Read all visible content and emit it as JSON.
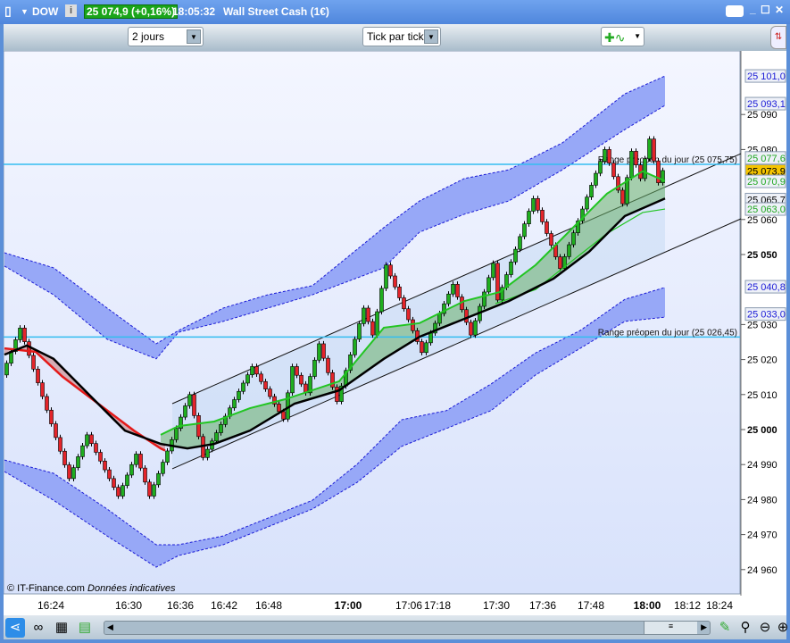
{
  "title_bar": {
    "instrument": "DOW",
    "price": "25 074,9 (+0,16%)",
    "time": "18:05:32",
    "name": "Wall Street Cash (1€)"
  },
  "toolbar": {
    "period": "2 jours",
    "granularity": "Tick par tick"
  },
  "watermark": {
    "copyright": "© IT-Finance.com",
    "note": "Données indicatives"
  },
  "colors": {
    "up": "#1fae1f",
    "down": "#e4242a",
    "band": "#97a8f7",
    "band_edge": "#1b1bd6",
    "cyan": "#33bdf0",
    "ma_red": "#e41a1a",
    "ma_black": "#000000",
    "ma_green": "#22c522"
  },
  "chart_data": {
    "type": "candlestick",
    "title": "Wall Street Cash (1€) - Tick par tick - 2 jours",
    "ylim": [
      24955,
      25110
    ],
    "x_unit": "bar index",
    "xlim": [
      0,
      166
    ],
    "y_ticks": [
      25090,
      25080,
      25060,
      25050,
      25030,
      25020,
      25010,
      25000,
      24990,
      24980,
      24970,
      24960
    ],
    "y_ticks_labels": [
      "25 090",
      "25 080",
      "25 060",
      "25 050",
      "25 030",
      "25 020",
      "25 010",
      "25 000",
      "24 990",
      "24 980",
      "24 970",
      "24 960"
    ],
    "bold_ticks": [
      25050,
      25000
    ],
    "price_labels": [
      {
        "v": 25101.0,
        "text": "25 101,0",
        "color": "#1b1bd6"
      },
      {
        "v": 25093.1,
        "text": "25 093,1",
        "color": "#1b1bd6"
      },
      {
        "v": 25077.6,
        "text": "25 077,6",
        "color": "#22a822"
      },
      {
        "v": 25073.9,
        "text": "25 073,9",
        "color": "#000000",
        "bg": "#f5c400"
      },
      {
        "v": 25070.9,
        "text": "25 070,9",
        "color": "#22a822"
      },
      {
        "v": 25065.7,
        "text": "25 065,7",
        "color": "#000000"
      },
      {
        "v": 25063.0,
        "text": "25 063,0",
        "color": "#22a822"
      },
      {
        "v": 25040.8,
        "text": "25 040,8",
        "color": "#1b1bd6"
      },
      {
        "v": 25033.0,
        "text": "25 033,0",
        "color": "#1b1bd6"
      }
    ],
    "x_ticks": [
      {
        "i": 10.4,
        "label": "16:24"
      },
      {
        "i": 27.8,
        "label": "16:30"
      },
      {
        "i": 39.4,
        "label": "16:36"
      },
      {
        "i": 49.2,
        "label": "16:42"
      },
      {
        "i": 59.2,
        "label": "16:48"
      },
      {
        "i": 77,
        "label": "17:00",
        "bold": true
      },
      {
        "i": 90.6,
        "label": "17:06"
      },
      {
        "i": 97,
        "label": "17:18"
      },
      {
        "i": 110.2,
        "label": "17:30"
      },
      {
        "i": 120.6,
        "label": "17:36"
      },
      {
        "i": 131.4,
        "label": "17:48"
      },
      {
        "i": 144,
        "label": "18:00",
        "bold": true
      },
      {
        "i": 153,
        "label": "18:12"
      },
      {
        "i": 160.2,
        "label": "18:24"
      }
    ],
    "swings": [
      [
        0,
        25015.6
      ],
      [
        4,
        25029
      ],
      [
        15,
        24986
      ],
      [
        19,
        24998.5
      ],
      [
        26,
        24981
      ],
      [
        30,
        24993
      ],
      [
        33,
        24981
      ],
      [
        42,
        25010
      ],
      [
        45,
        24992
      ],
      [
        56,
        25018
      ],
      [
        63,
        25003
      ],
      [
        65,
        25018
      ],
      [
        68,
        25010.5
      ],
      [
        71,
        25024.5
      ],
      [
        75,
        25008
      ],
      [
        81,
        25034.7
      ],
      [
        83,
        25027
      ],
      [
        86,
        25047
      ],
      [
        94,
        25022
      ],
      [
        101,
        25041.5
      ],
      [
        105,
        25027
      ],
      [
        110,
        25047.5
      ],
      [
        111,
        25037
      ],
      [
        119,
        25066
      ],
      [
        125,
        25046
      ],
      [
        135,
        25080
      ],
      [
        139,
        25064.5
      ],
      [
        141,
        25079.5
      ],
      [
        143,
        25071.7
      ],
      [
        145,
        25083
      ],
      [
        147,
        25070.5
      ],
      [
        148,
        25074
      ]
    ],
    "upper_band": [
      [
        0,
        25050.5,
        25046.7
      ],
      [
        11,
        25046.2,
        25038.5
      ],
      [
        23,
        25034.7,
        25025.8
      ],
      [
        34,
        25024.5,
        25020.2
      ],
      [
        39,
        25028.3,
        25027.8
      ],
      [
        49,
        25034.7,
        25030.9
      ],
      [
        59,
        25038.5,
        25034.7
      ],
      [
        69,
        25041.1,
        25038.5
      ],
      [
        85,
        25057.7,
        25046.2
      ],
      [
        93,
        25065.3,
        25056.4
      ],
      [
        103,
        25071.7,
        25061.5
      ],
      [
        113,
        25074.2,
        25065.3
      ],
      [
        125,
        25081.9,
        25074.2
      ],
      [
        139,
        25095.9,
        25085.7
      ],
      [
        148,
        25101,
        25092.6
      ]
    ],
    "lower_band": [
      [
        0,
        24991.3,
        24988.0
      ],
      [
        11,
        24987.5,
        24979.8
      ],
      [
        23,
        24977.3,
        24969.6
      ],
      [
        34,
        24967.1,
        24960.7
      ],
      [
        39,
        24967.1,
        24964.0
      ],
      [
        49,
        24969.6,
        24967.1
      ],
      [
        59,
        24974.7,
        24972.2
      ],
      [
        69,
        24979.8,
        24977.3
      ],
      [
        79,
        24990.1,
        24984.9
      ],
      [
        89,
        25002.8,
        24995.2
      ],
      [
        99,
        25005.4,
        25000.3
      ],
      [
        109,
        25013.0,
        25005.4
      ],
      [
        119,
        25021.9,
        25015.6
      ],
      [
        129,
        25028.3,
        25023.2
      ],
      [
        139,
        25037.2,
        25030.9
      ],
      [
        148,
        25040.6,
        25032.1
      ]
    ],
    "ma_red": [
      [
        0,
        25023.2
      ],
      [
        7,
        25022.2
      ],
      [
        13,
        25015.1
      ],
      [
        21,
        25007.4
      ],
      [
        29,
        24999.7
      ],
      [
        35,
        24994.6
      ],
      [
        36,
        24994
      ]
    ],
    "ma_black": [
      [
        0,
        25021.4
      ],
      [
        5,
        25024
      ],
      [
        11,
        25020.2
      ],
      [
        19,
        25009.9
      ],
      [
        27,
        24999.7
      ],
      [
        35,
        24995.9
      ],
      [
        41,
        24994.6
      ],
      [
        47,
        24995.9
      ],
      [
        55,
        24999.7
      ],
      [
        65,
        25007.4
      ],
      [
        75,
        25011.2
      ],
      [
        85,
        25020.2
      ],
      [
        93,
        25026.5
      ],
      [
        103,
        25031.6
      ],
      [
        113,
        25036.7
      ],
      [
        123,
        25043.1
      ],
      [
        131,
        25050.8
      ],
      [
        139,
        25061.0
      ],
      [
        148,
        25066.0
      ]
    ],
    "ma_green": [
      [
        35,
        24998.5
      ],
      [
        39,
        25001
      ],
      [
        47,
        25002.3
      ],
      [
        55,
        25006.1
      ],
      [
        63,
        25008.7
      ],
      [
        75,
        25013.8
      ],
      [
        85,
        25029.1
      ],
      [
        93,
        25030.4
      ],
      [
        103,
        25036.7
      ],
      [
        111,
        25039.3
      ],
      [
        119,
        25047.0
      ],
      [
        127,
        25057.2
      ],
      [
        135,
        25067.4
      ],
      [
        143,
        25073.8
      ],
      [
        148,
        25071
      ]
    ],
    "ma_green_lower": [
      [
        110,
        25036
      ],
      [
        119,
        25040
      ],
      [
        127,
        25048
      ],
      [
        135,
        25056
      ],
      [
        143,
        25062
      ],
      [
        148,
        25063
      ]
    ],
    "channel": {
      "upper": [
        [
          37.6,
          25007.4
        ],
        [
          165,
          25078.8
        ]
      ],
      "lower": [
        [
          37.6,
          24988.8
        ],
        [
          165,
          25060.2
        ]
      ]
    },
    "hlines": [
      {
        "v": 25075.75,
        "label": "Range préopen du jour (25 075,75)"
      },
      {
        "v": 25026.45,
        "label": "Range préopen du jour (25 026,45)"
      }
    ]
  }
}
